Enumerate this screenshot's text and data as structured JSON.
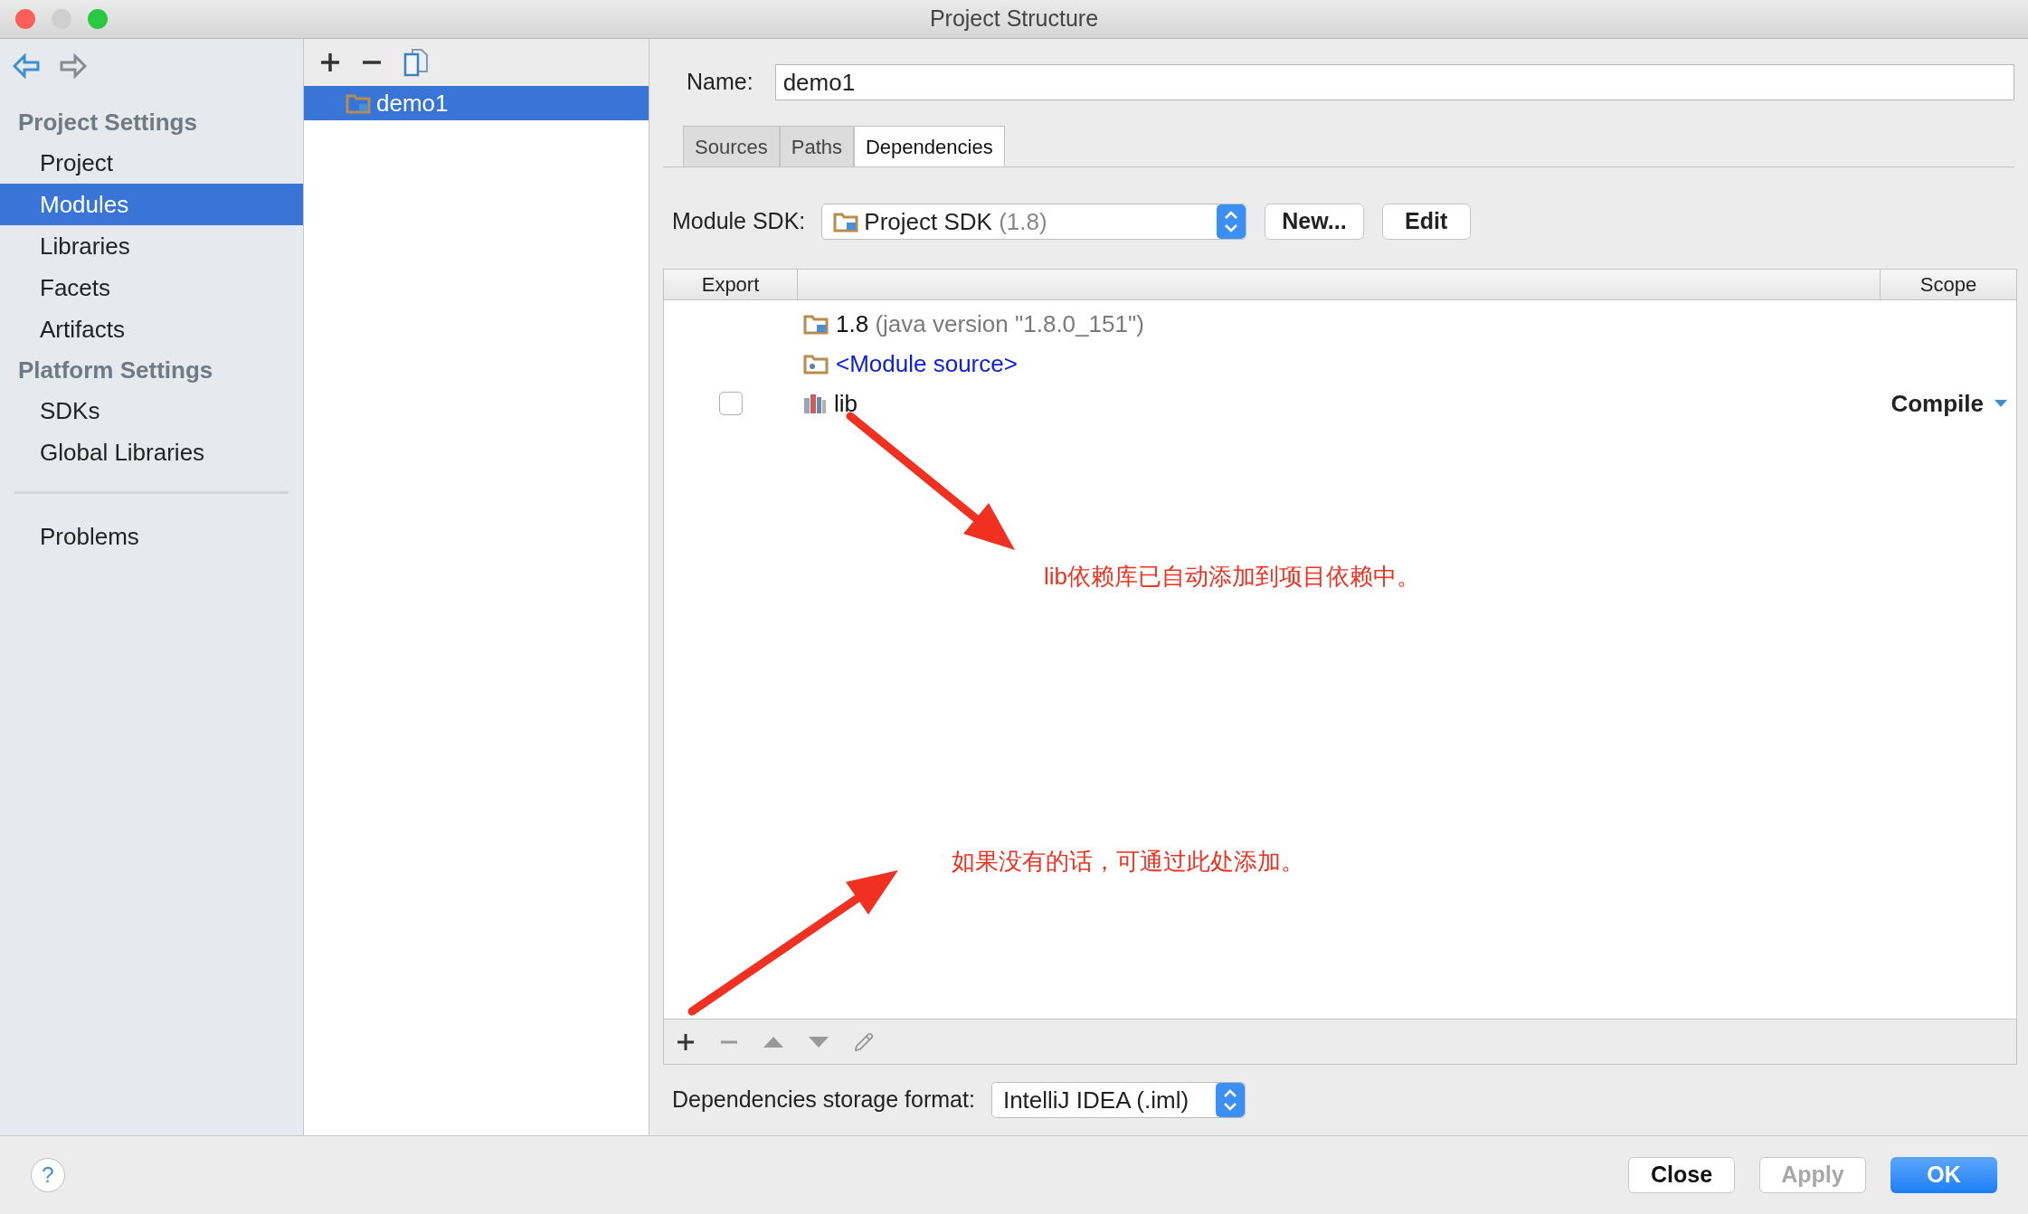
{
  "window": {
    "title": "Project Structure"
  },
  "sidebar": {
    "sections": [
      {
        "heading": "Project Settings",
        "items": [
          {
            "label": "Project",
            "selected": false
          },
          {
            "label": "Modules",
            "selected": true
          },
          {
            "label": "Libraries",
            "selected": false
          },
          {
            "label": "Facets",
            "selected": false
          },
          {
            "label": "Artifacts",
            "selected": false
          }
        ]
      },
      {
        "heading": "Platform Settings",
        "items": [
          {
            "label": "SDKs",
            "selected": false
          },
          {
            "label": "Global Libraries",
            "selected": false
          }
        ]
      }
    ],
    "bottom_items": [
      {
        "label": "Problems",
        "selected": false
      }
    ]
  },
  "modules": [
    {
      "name": "demo1",
      "selected": true
    }
  ],
  "name_field": {
    "label": "Name:",
    "value": "demo1"
  },
  "tabs": [
    {
      "label": "Sources",
      "selected": false
    },
    {
      "label": "Paths",
      "selected": false
    },
    {
      "label": "Dependencies",
      "selected": true
    }
  ],
  "module_sdk": {
    "label": "Module SDK:",
    "value": "Project SDK",
    "detail": "(1.8)",
    "buttons": [
      "New...",
      "Edit"
    ]
  },
  "table": {
    "columns": [
      "Export",
      "Scope"
    ],
    "rows": [
      {
        "kind": "sdk",
        "name": "1.8",
        "detail": "(java version \"1.8.0_151\")"
      },
      {
        "kind": "source",
        "name": "<Module source>"
      },
      {
        "kind": "library",
        "name": "lib",
        "checked": false,
        "scope": "Compile"
      }
    ]
  },
  "annotations": [
    {
      "text": "lib依赖库已自动添加到项目依赖中。"
    },
    {
      "text": "如果没有的话，可通过此处添加。"
    }
  ],
  "storage_format": {
    "label": "Dependencies storage format:",
    "value": "IntelliJ IDEA (.iml)"
  },
  "footer": {
    "help": "?",
    "buttons": [
      {
        "label": "Close",
        "kind": "normal",
        "disabled": false
      },
      {
        "label": "Apply",
        "kind": "normal",
        "disabled": true
      },
      {
        "label": "OK",
        "kind": "default",
        "disabled": false
      }
    ]
  }
}
